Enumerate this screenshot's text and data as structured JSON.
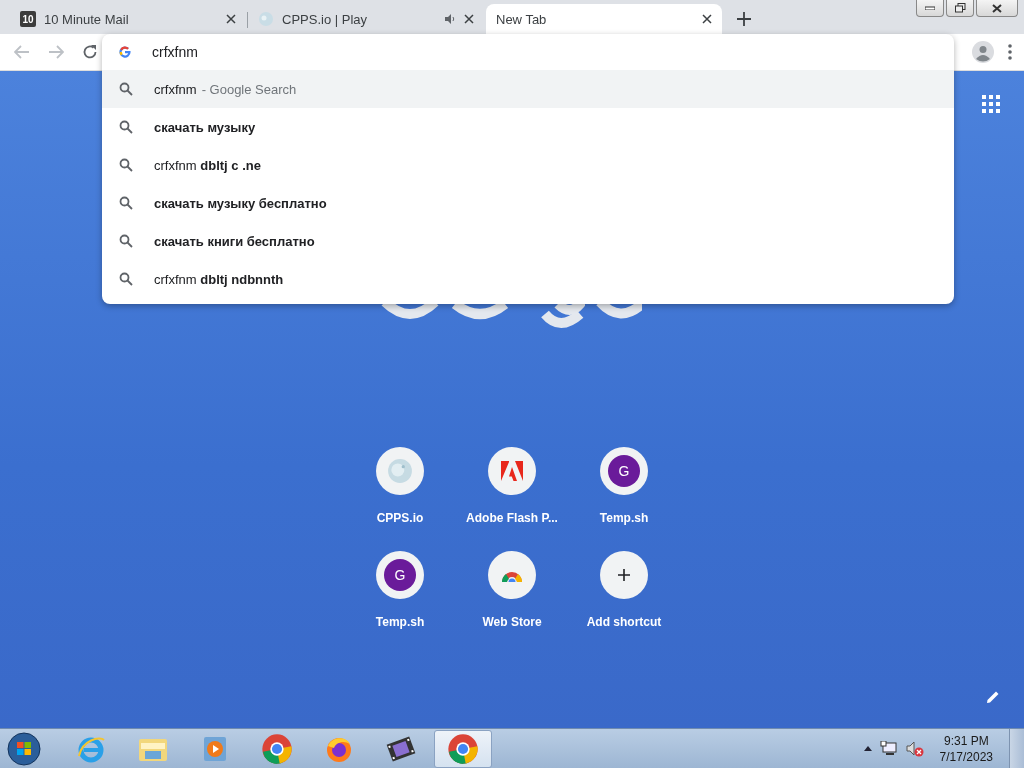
{
  "tabs": [
    {
      "title": "10 Minute Mail",
      "favicon": "10",
      "kind": "text-icon",
      "audio": false,
      "selected": false
    },
    {
      "title": "CPPS.io | Play",
      "kind": "globe",
      "audio": true,
      "selected": false
    },
    {
      "title": "New Tab",
      "kind": "none",
      "audio": false,
      "selected": true
    }
  ],
  "omnibox": {
    "value": "crfxfnm"
  },
  "suggestions": [
    {
      "query": "crfxfnm",
      "hint": "- Google Search",
      "selected": true
    },
    {
      "completion": "скачать музыку",
      "selected": false
    },
    {
      "query": "crfxfnm",
      "completion": "dbltj c .ne",
      "selected": false
    },
    {
      "completion": "скачать музыку бесплатно",
      "selected": false
    },
    {
      "completion": "скачать книги бесплатно",
      "selected": false
    },
    {
      "query": "crfxfnm",
      "completion": "dbltj ndbnnth",
      "selected": false
    }
  ],
  "shortcuts": [
    {
      "label": "CPPS.io",
      "kind": "globe"
    },
    {
      "label": "Adobe Flash P...",
      "kind": "adobe"
    },
    {
      "label": "Temp.sh",
      "kind": "letter",
      "letter": "G"
    },
    {
      "label": "Temp.sh",
      "kind": "letter",
      "letter": "G"
    },
    {
      "label": "Web Store",
      "kind": "webstore"
    },
    {
      "label": "Add shortcut",
      "kind": "add"
    }
  ],
  "taskbar": {
    "items": [
      {
        "kind": "ie",
        "selected": false
      },
      {
        "kind": "explorer",
        "selected": false
      },
      {
        "kind": "media",
        "selected": false
      },
      {
        "kind": "chrome",
        "selected": false
      },
      {
        "kind": "firefox",
        "selected": false
      },
      {
        "kind": "movie",
        "selected": false
      },
      {
        "kind": "chrome",
        "selected": true
      }
    ],
    "time": "9:31 PM",
    "date": "7/17/2023"
  }
}
